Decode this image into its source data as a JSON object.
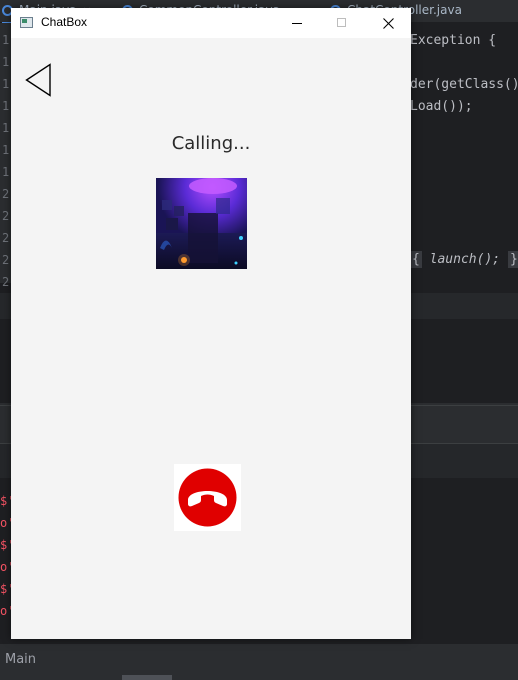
{
  "ide": {
    "tabs": [
      {
        "label": "Main.java",
        "active": true
      },
      {
        "label": "CommonController.java",
        "active": false
      },
      {
        "label": "ChatController.java",
        "active": false
      }
    ],
    "tab_close": "×",
    "line_numbers": [
      "1",
      "1",
      "1",
      "1",
      "1",
      "1",
      "1",
      "2",
      "2",
      "2",
      "2",
      "2"
    ],
    "code_lines": {
      "line1": "Exception {",
      "line2": "der(getClass()",
      "line3": "Load());",
      "line4_open": "{",
      "line4_call": "launch();",
      "line4_close": "}"
    },
    "console_fragments": [
      "$'",
      "o'",
      "$'",
      "o'",
      "$'",
      "o'"
    ],
    "status_label": "Main"
  },
  "window": {
    "title": "ChatBox",
    "controls": {
      "minimize": "minimize-icon",
      "maximize": "maximize-icon",
      "close": "close-icon"
    }
  },
  "call": {
    "status": "Calling...",
    "back_icon": "back-triangle-icon",
    "hangup_icon": "hang-up-phone-icon",
    "hangup_color": "#e00000"
  }
}
